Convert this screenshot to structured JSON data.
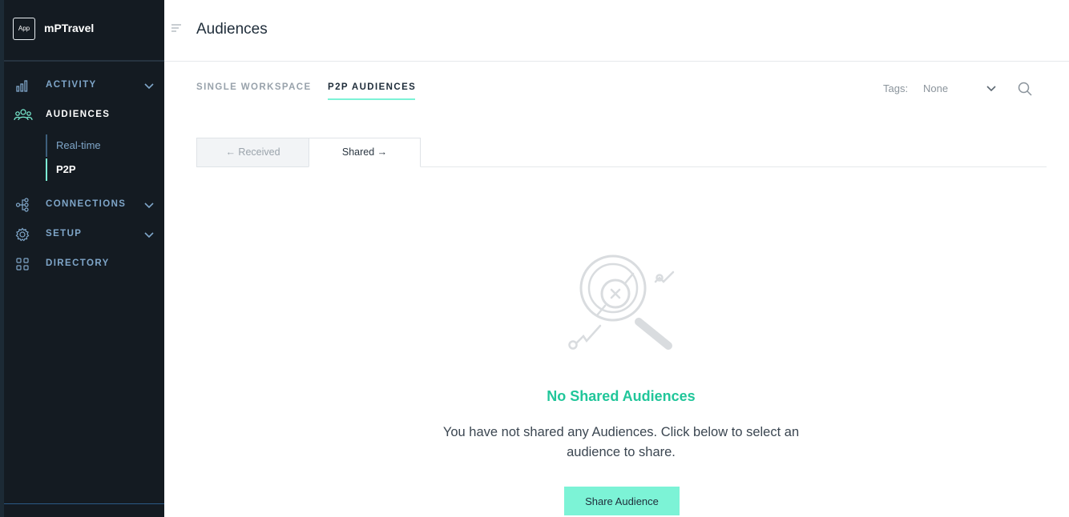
{
  "app": {
    "logo_text": "App",
    "name": "mPTravel"
  },
  "sidebar": {
    "items": [
      {
        "label": "ACTIVITY",
        "icon": "bar-chart-icon",
        "has_chevron": true
      },
      {
        "label": "AUDIENCES",
        "icon": "users-icon",
        "active": true
      },
      {
        "label": "CONNECTIONS",
        "icon": "connections-icon",
        "has_chevron": true
      },
      {
        "label": "SETUP",
        "icon": "gear-icon",
        "has_chevron": true
      },
      {
        "label": "DIRECTORY",
        "icon": "grid-icon"
      }
    ],
    "audiences_subitems": [
      {
        "label": "Real-time"
      },
      {
        "label": "P2P",
        "active": true
      }
    ]
  },
  "header": {
    "title": "Audiences"
  },
  "tabs": [
    {
      "label": "SINGLE WORKSPACE"
    },
    {
      "label": "P2P AUDIENCES",
      "active": true
    }
  ],
  "filters": {
    "tags_label": "Tags:",
    "tags_value": "None"
  },
  "segments": {
    "received": "← Received",
    "shared": "Shared →"
  },
  "empty_state": {
    "title": "No Shared Audiences",
    "message": "You have not shared any Audiences. Click below to select an audience to share.",
    "button": "Share Audience"
  },
  "colors": {
    "sidebar_bg": "#141b22",
    "accent": "#7cf3d6",
    "accent_text": "#21c69a",
    "nav_text": "#7fa6c9"
  }
}
